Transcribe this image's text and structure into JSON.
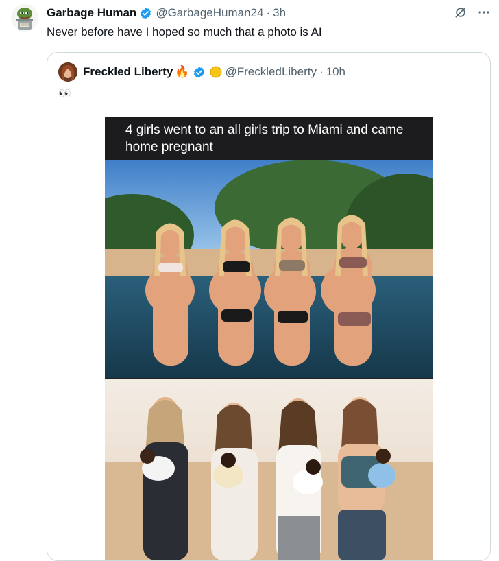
{
  "tweet": {
    "author_name": "Garbage Human",
    "author_handle": "@GarbageHuman24",
    "separator": "·",
    "time": "3h",
    "text": "Never before have I hoped so much that a photo is AI"
  },
  "quoted": {
    "author_name": "Freckled Liberty",
    "emoji_badges": "🔥",
    "author_handle": "@FreckledLiberty",
    "separator": "·",
    "time": "10h",
    "text": "👀",
    "image_caption": "4 girls went to an all girls trip to Miami and came home pregnant"
  },
  "icons": {
    "verified": "verified-badge-icon",
    "grok": "grok-icon",
    "more": "more-options-icon"
  },
  "colors": {
    "verified_blue": "#1d9bf0",
    "text_primary": "#0f1419",
    "text_secondary": "#536471",
    "border": "#cfd9de"
  }
}
